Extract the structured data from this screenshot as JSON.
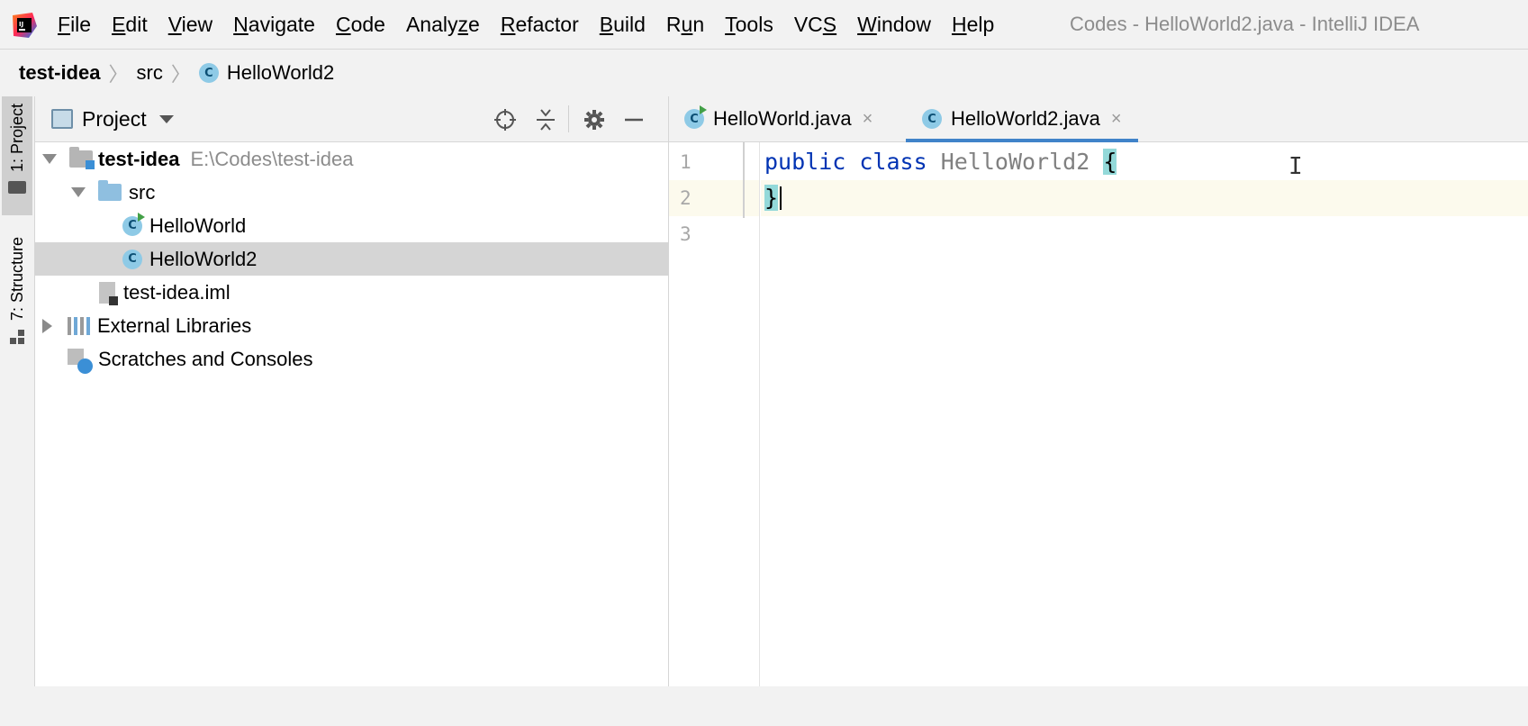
{
  "window": {
    "title": "Codes - HelloWorld2.java - IntelliJ IDEA",
    "app_icon": "intellij-idea-logo"
  },
  "menu": {
    "items": [
      {
        "mnemonic": "F",
        "rest": "ile"
      },
      {
        "mnemonic": "E",
        "rest": "dit"
      },
      {
        "mnemonic": "V",
        "rest": "iew"
      },
      {
        "mnemonic": "N",
        "rest": "avigate"
      },
      {
        "mnemonic": "C",
        "rest": "ode"
      },
      {
        "pre": "Analy",
        "mnemonic": "z",
        "rest": "e"
      },
      {
        "mnemonic": "R",
        "rest": "efactor"
      },
      {
        "mnemonic": "B",
        "rest": "uild"
      },
      {
        "pre": "R",
        "mnemonic": "u",
        "rest": "n"
      },
      {
        "mnemonic": "T",
        "rest": "ools"
      },
      {
        "pre": "VC",
        "mnemonic": "S",
        "rest": ""
      },
      {
        "mnemonic": "W",
        "rest": "indow"
      },
      {
        "mnemonic": "H",
        "rest": "elp"
      }
    ]
  },
  "breadcrumb": {
    "project": "test-idea",
    "folder": "src",
    "file": "HelloWorld2",
    "file_icon_letter": "C"
  },
  "tool_stripe": {
    "project_label": "1: Project",
    "structure_label": "7: Structure"
  },
  "project_panel": {
    "title": "Project",
    "icons": [
      "locate-icon",
      "collapse-all-icon",
      "gear-icon",
      "hide-icon"
    ],
    "tree": {
      "root_name": "test-idea",
      "root_path": "E:\\Codes\\test-idea",
      "src": "src",
      "file1": "HelloWorld",
      "file2": "HelloWorld2",
      "iml": "test-idea.iml",
      "libraries": "External Libraries",
      "scratches": "Scratches and Consoles",
      "class_icon_letter": "C"
    }
  },
  "editor": {
    "tabs": [
      {
        "label": "HelloWorld.java",
        "close": "×"
      },
      {
        "label": "HelloWorld2.java",
        "close": "×"
      }
    ],
    "line_numbers": [
      "1",
      "2",
      "3"
    ],
    "code": {
      "kw_public": "public",
      "kw_class": "class",
      "class_name": "HelloWorld2",
      "open_brace": "{",
      "close_brace": "}"
    },
    "colors": {
      "keyword": "#0033b3",
      "class_name": "#808080",
      "brace_match": "#93d9d9",
      "current_line": "#fcfaed",
      "active_tab_underline": "#4083c9"
    }
  }
}
